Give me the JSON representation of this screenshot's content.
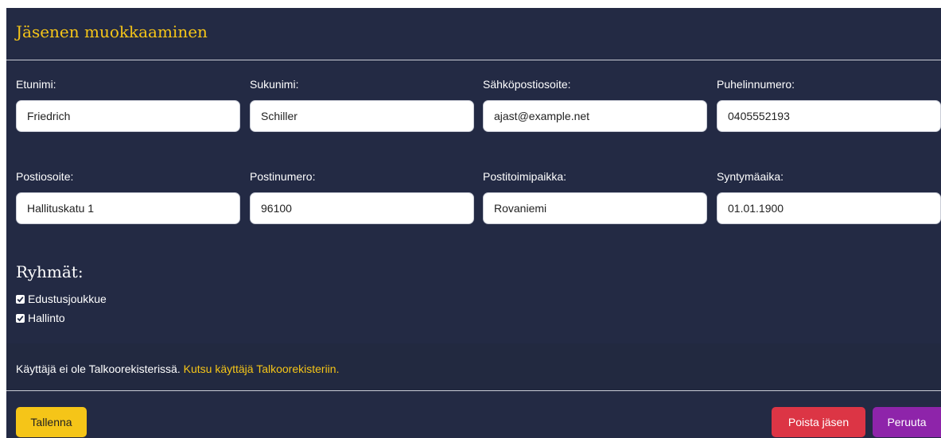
{
  "modal": {
    "title": "Jäsenen muokkaaminen"
  },
  "fields": {
    "first_name": {
      "label": "Etunimi:",
      "value": "Friedrich"
    },
    "last_name": {
      "label": "Sukunimi:",
      "value": "Schiller"
    },
    "email": {
      "label": "Sähköpostiosoite:",
      "value": "ajast@example.net"
    },
    "phone": {
      "label": "Puhelinnumero:",
      "value": "0405552193"
    },
    "address": {
      "label": "Postiosoite:",
      "value": "Hallituskatu 1"
    },
    "postal_code": {
      "label": "Postinumero:",
      "value": "96100"
    },
    "city": {
      "label": "Postitoimipaikka:",
      "value": "Rovaniemi"
    },
    "birthdate": {
      "label": "Syntymäaika:",
      "value": "01.01.1900"
    }
  },
  "groups": {
    "title": "Ryhmät:",
    "items": [
      {
        "label": "Edustusjoukkue",
        "checked": true
      },
      {
        "label": "Hallinto",
        "checked": true
      }
    ]
  },
  "notice": {
    "text": "Käyttäjä ei ole Talkoorekisterissä. ",
    "link": "Kutsu käyttäjä Talkoorekisteriin."
  },
  "footer": {
    "save_label": "Tallenna",
    "delete_label": "Poista jäsen",
    "cancel_label": "Peruuta"
  },
  "colors": {
    "background": "#232a44",
    "accent": "#f5c518",
    "danger": "#dc3545",
    "cancel": "#8e24aa"
  },
  "icons": {
    "checkbox": "checkbox-checked-icon"
  }
}
